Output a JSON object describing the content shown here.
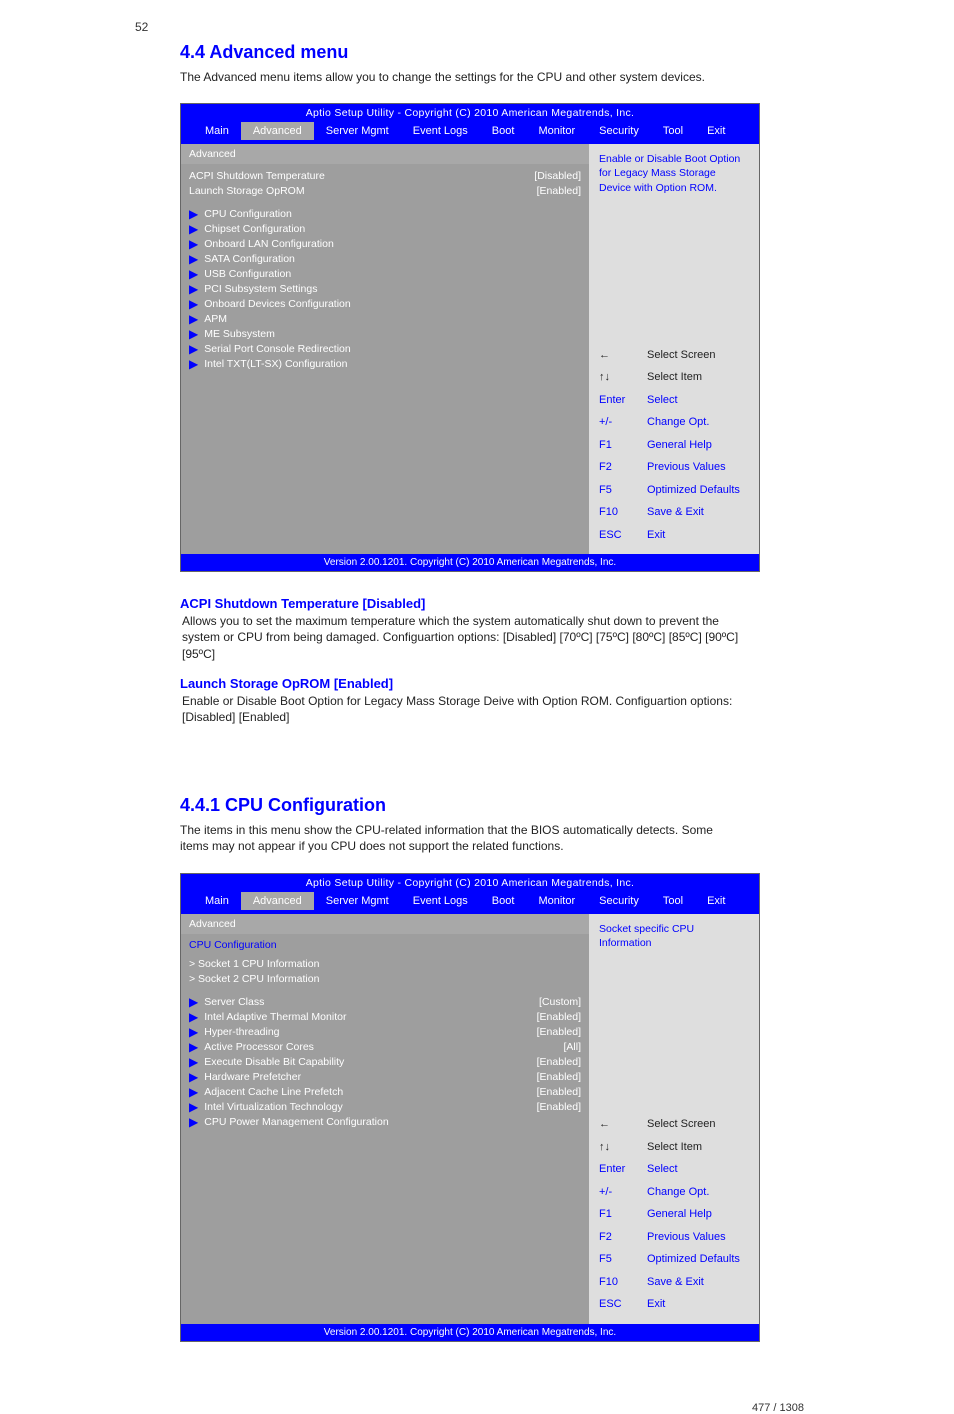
{
  "page_number_top": "52",
  "section1": {
    "title": "4.4    Advanced menu",
    "intro": "The Advanced menu items allow you to change the settings for the CPU and other system devices.",
    "bios": {
      "utility_title": "Aptio Setup Utility - Copyright (C) 2010 American Megatrends, Inc.",
      "tabs": [
        "Main",
        "Advanced",
        "Server Mgmt",
        "Event Logs",
        "Boot",
        "Monitor",
        "Security",
        "Tool",
        "Exit"
      ],
      "active_tab": 1,
      "subtitle": "Advanced",
      "settings": [
        {
          "label": "ACPI Shutdown Temperature",
          "value": "[Disabled]"
        },
        {
          "label": "Launch Storage OpROM",
          "value": "[Enabled]"
        }
      ],
      "submenus": [
        "CPU Configuration",
        "Chipset Configuration",
        "Onboard LAN Configuration",
        "SATA Configuration",
        "USB Configuration",
        "PCI Subsystem Settings",
        "Onboard Devices Configuration",
        "APM",
        "ME Subsystem",
        "Serial Port Console Redirection",
        "Intel TXT(LT-SX) Configuration"
      ],
      "help_text": "Enable or Disable Boot Option for Legacy Mass Storage Device with Option ROM.",
      "help_keys": [
        {
          "k": "←",
          "d": "Select Screen",
          "accent": false
        },
        {
          "k": "↑↓",
          "d": "Select Item",
          "accent": false
        },
        {
          "k": "Enter",
          "d": "Select",
          "accent": true
        },
        {
          "k": "+/-",
          "d": "Change Opt.",
          "accent": true
        },
        {
          "k": "F1",
          "d": "General Help",
          "accent": true
        },
        {
          "k": "F2",
          "d": "Previous Values",
          "accent": true
        },
        {
          "k": "F5",
          "d": "Optimized Defaults",
          "accent": true
        },
        {
          "k": "F10",
          "d": "Save & Exit",
          "accent": true
        },
        {
          "k": "ESC",
          "d": "Exit",
          "accent": true
        }
      ],
      "footer": "Version 2.00.1201. Copyright (C) 2010 American Megatrends, Inc."
    },
    "items_after": [
      {
        "name": "ACPI Shutdown Temperature [Disabled]",
        "desc": "Allows you to set the maximum temperature which the system automatically shut down to prevent the system or CPU from being damaged.  Configuartion options: [Disabled] [70ºC] [75ºC] [80ºC] [85ºC] [90ºC] [95ºC]",
        "noarrow": true
      },
      {
        "name": "Launch Storage OpROM [Enabled]",
        "desc": "Enable or Disable Boot Option for Legacy Mass Storage Deive with Option ROM.  Configuartion options: [Disabled] [Enabled]",
        "noarrow": true
      }
    ]
  },
  "section2": {
    "title": "4.4.1    CPU Configuration",
    "intro": "The items in this menu show the CPU-related information that the BIOS automatically detects. Some items may not appear if you CPU does not support the related functions.",
    "bios": {
      "utility_title": "Aptio Setup Utility - Copyright (C) 2010 American Megatrends, Inc.",
      "tabs": [
        "Main",
        "Advanced",
        "Server Mgmt",
        "Event Logs",
        "Boot",
        "Monitor",
        "Security",
        "Tool",
        "Exit"
      ],
      "active_tab": 1,
      "subtitle": "Advanced",
      "header_line": "CPU Configuration",
      "settings": [
        {
          "label": "> Socket 1 CPU Information",
          "value": ""
        },
        {
          "label": "> Socket 2 CPU Information",
          "value": ""
        }
      ],
      "submenus": [
        "Server Class",
        "Intel Adaptive Thermal Monitor",
        "Hyper-threading",
        "Active Processor Cores",
        "Execute Disable Bit Capability",
        "Hardware Prefetcher",
        "Adjacent Cache Line Prefetch",
        "Intel Virtualization Technology",
        "CPU Power Management Configuration"
      ],
      "setting_values": [
        {
          "label": "Server Class",
          "value": "[Custom]"
        },
        {
          "label": "Intel Adaptive Thermal Monitor",
          "value": "[Enabled]"
        },
        {
          "label": "Hyper-threading",
          "value": "[Enabled]"
        },
        {
          "label": "Active Processor Cores",
          "value": "[All]"
        },
        {
          "label": "Execute Disable Bit Capability",
          "value": "[Enabled]"
        },
        {
          "label": "Hardware Prefetcher",
          "value": "[Enabled]"
        },
        {
          "label": "Adjacent Cache Line Prefetch",
          "value": "[Enabled]"
        },
        {
          "label": "Intel Virtualization Technology",
          "value": "[Enabled]"
        }
      ],
      "help_text": "Socket specific CPU Information",
      "help_keys": [
        {
          "k": "←",
          "d": "Select Screen",
          "accent": false
        },
        {
          "k": "↑↓",
          "d": "Select Item",
          "accent": false
        },
        {
          "k": "Enter",
          "d": "Select",
          "accent": true
        },
        {
          "k": "+/-",
          "d": "Change Opt.",
          "accent": true
        },
        {
          "k": "F1",
          "d": "General Help",
          "accent": true
        },
        {
          "k": "F2",
          "d": "Previous Values",
          "accent": true
        },
        {
          "k": "F5",
          "d": "Optimized Defaults",
          "accent": true
        },
        {
          "k": "F10",
          "d": "Save & Exit",
          "accent": true
        },
        {
          "k": "ESC",
          "d": "Exit",
          "accent": true
        }
      ],
      "footer": "Version 2.00.1201. Copyright (C) 2010 American Megatrends, Inc."
    }
  },
  "pager": "477 / 1308"
}
